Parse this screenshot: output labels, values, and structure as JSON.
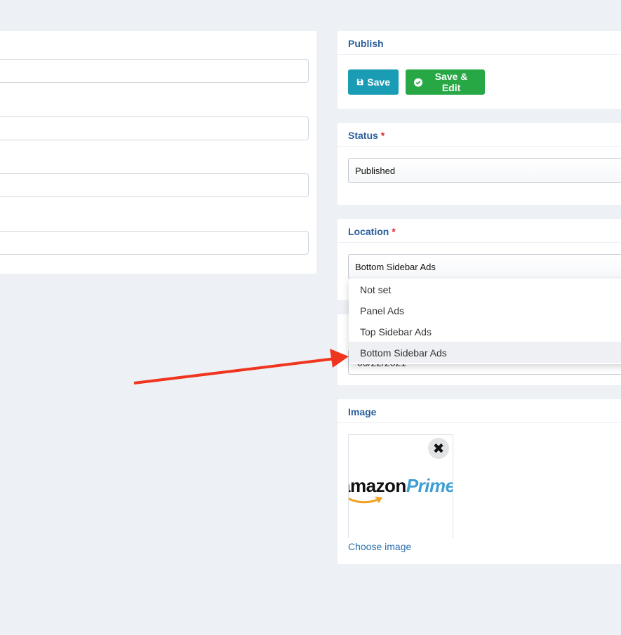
{
  "publish": {
    "title": "Publish",
    "save_label": "Save",
    "save_edit_label": "Save & Edit"
  },
  "status": {
    "title": "Status",
    "required_mark": "*",
    "selected": "Published"
  },
  "location": {
    "title": "Location",
    "required_mark": "*",
    "selected": "Bottom Sidebar Ads",
    "options": [
      "Not set",
      "Panel Ads",
      "Top Sidebar Ads",
      "Bottom Sidebar Ads"
    ]
  },
  "date": {
    "value": "06/22/2021"
  },
  "image": {
    "title": "Image",
    "logo_text": "amazon",
    "logo_text_2": "Prime",
    "remove_symbol": "✖",
    "choose_label": "Choose image"
  },
  "colors": {
    "save_button": "#1a9cb5",
    "save_edit_button": "#28a745",
    "header_text": "#2a5f9c",
    "annotation_arrow": "#f0351f"
  },
  "icons": {
    "save": "floppy-disk-icon",
    "save_edit": "check-circle-icon",
    "remove": "close-icon"
  }
}
